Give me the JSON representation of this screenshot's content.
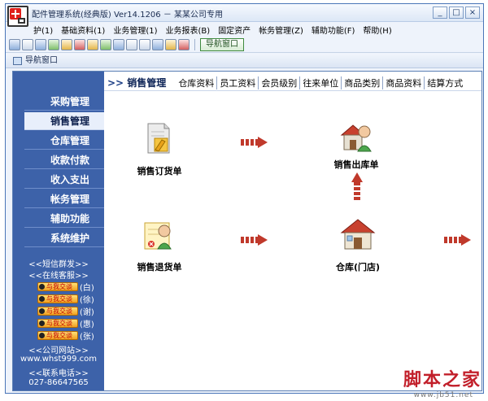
{
  "window": {
    "title": "配件管理系统(经典版) Ver14.1206 － 某某公司专用",
    "minimize": "_",
    "maximize": "□",
    "close": "×"
  },
  "menu": [
    "护(1)",
    "基础资料(1)",
    "业务管理(1)",
    "业务报表(B)",
    "固定资产",
    "帐务管理(Z)",
    "辅助功能(F)",
    "帮助(H)"
  ],
  "toolbar": {
    "nav_button": "导航窗口"
  },
  "nav_tab": {
    "label": "导航窗口"
  },
  "sidebar": {
    "items": [
      {
        "label": "采购管理"
      },
      {
        "label": "销售管理",
        "active": true
      },
      {
        "label": "仓库管理"
      },
      {
        "label": "收款付款"
      },
      {
        "label": "收入支出"
      },
      {
        "label": "帐务管理"
      },
      {
        "label": "辅助功能"
      },
      {
        "label": "系统维护"
      }
    ],
    "sms": "<<短信群发>>",
    "online": "<<在线客服>>",
    "qq": [
      {
        "badge": "与我交谈",
        "name": "(白)"
      },
      {
        "badge": "与我交谈",
        "name": "(徐)"
      },
      {
        "badge": "与我交谈",
        "name": "(谢)"
      },
      {
        "badge": "与我交谈",
        "name": "(惠)"
      },
      {
        "badge": "与我交谈",
        "name": "(张)"
      }
    ],
    "website_title": "<<公司网站>>",
    "website": "www.whst999.com",
    "phone_title": "<<联系电话>>",
    "phone": "027-86647565"
  },
  "main": {
    "breadcrumb_arrows": ">>",
    "breadcrumb": "销售管理",
    "tabs": [
      "仓库资料",
      "员工资料",
      "会员级别",
      "往来单位",
      "商品类别",
      "商品资料",
      "结算方式"
    ],
    "nodes": {
      "sales_order": "销售订货单",
      "sales_out": "销售出库单",
      "sales_return": "销售退货单",
      "warehouse": "仓库(门店)"
    }
  },
  "watermark": {
    "text": "脚本之家",
    "url": "www.jb51.net"
  }
}
